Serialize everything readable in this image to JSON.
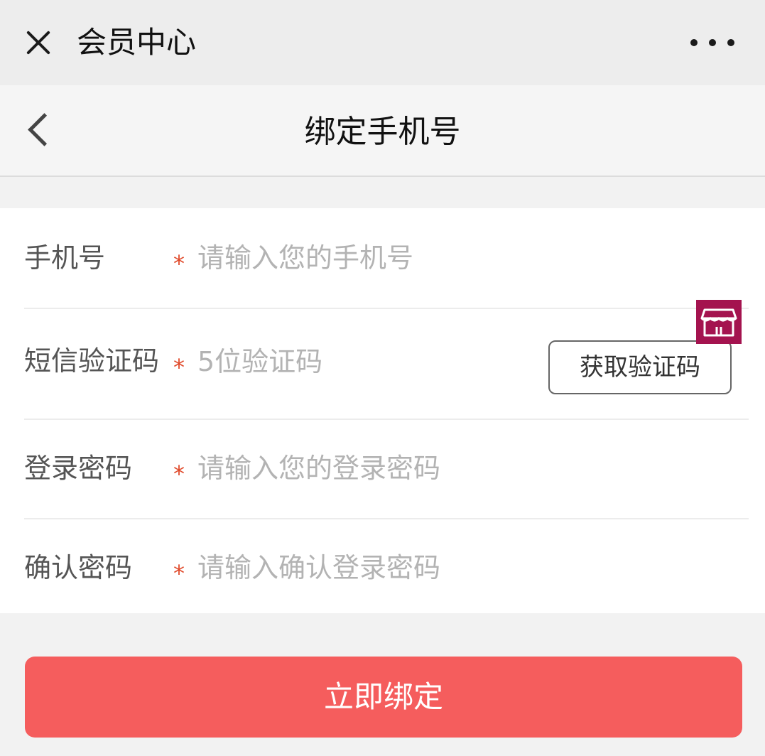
{
  "window": {
    "title": "会员中心"
  },
  "nav": {
    "title": "绑定手机号"
  },
  "form": {
    "fields": [
      {
        "label": "手机号",
        "required_mark": "*",
        "placeholder": "请输入您的手机号"
      },
      {
        "label": "短信验证码",
        "required_mark": "*",
        "placeholder": "5位验证码",
        "action_label": "获取验证码"
      },
      {
        "label": "登录密码",
        "required_mark": "*",
        "placeholder": "请输入您的登录密码"
      },
      {
        "label": "确认密码",
        "required_mark": "*",
        "placeholder": "请输入确认登录密码"
      }
    ]
  },
  "submit": {
    "label": "立即绑定"
  },
  "icons": {
    "close": "close-icon",
    "more": "more-icon",
    "back": "back-icon",
    "shop": "store-icon"
  },
  "colors": {
    "accent": "#f55d5d",
    "required_mark": "#e04a2b",
    "shop_badge": "#a4134f"
  }
}
